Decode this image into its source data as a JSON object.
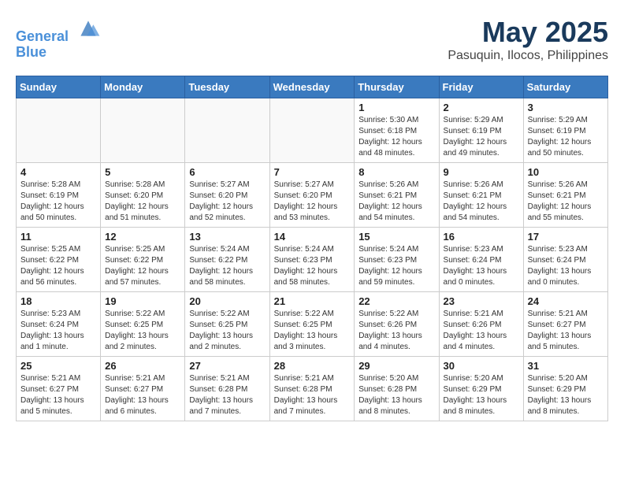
{
  "header": {
    "logo_line1": "General",
    "logo_line2": "Blue",
    "month_title": "May 2025",
    "location": "Pasuquin, Ilocos, Philippines"
  },
  "weekdays": [
    "Sunday",
    "Monday",
    "Tuesday",
    "Wednesday",
    "Thursday",
    "Friday",
    "Saturday"
  ],
  "weeks": [
    [
      {
        "day": "",
        "info": ""
      },
      {
        "day": "",
        "info": ""
      },
      {
        "day": "",
        "info": ""
      },
      {
        "day": "",
        "info": ""
      },
      {
        "day": "1",
        "info": "Sunrise: 5:30 AM\nSunset: 6:18 PM\nDaylight: 12 hours\nand 48 minutes."
      },
      {
        "day": "2",
        "info": "Sunrise: 5:29 AM\nSunset: 6:19 PM\nDaylight: 12 hours\nand 49 minutes."
      },
      {
        "day": "3",
        "info": "Sunrise: 5:29 AM\nSunset: 6:19 PM\nDaylight: 12 hours\nand 50 minutes."
      }
    ],
    [
      {
        "day": "4",
        "info": "Sunrise: 5:28 AM\nSunset: 6:19 PM\nDaylight: 12 hours\nand 50 minutes."
      },
      {
        "day": "5",
        "info": "Sunrise: 5:28 AM\nSunset: 6:20 PM\nDaylight: 12 hours\nand 51 minutes."
      },
      {
        "day": "6",
        "info": "Sunrise: 5:27 AM\nSunset: 6:20 PM\nDaylight: 12 hours\nand 52 minutes."
      },
      {
        "day": "7",
        "info": "Sunrise: 5:27 AM\nSunset: 6:20 PM\nDaylight: 12 hours\nand 53 minutes."
      },
      {
        "day": "8",
        "info": "Sunrise: 5:26 AM\nSunset: 6:21 PM\nDaylight: 12 hours\nand 54 minutes."
      },
      {
        "day": "9",
        "info": "Sunrise: 5:26 AM\nSunset: 6:21 PM\nDaylight: 12 hours\nand 54 minutes."
      },
      {
        "day": "10",
        "info": "Sunrise: 5:26 AM\nSunset: 6:21 PM\nDaylight: 12 hours\nand 55 minutes."
      }
    ],
    [
      {
        "day": "11",
        "info": "Sunrise: 5:25 AM\nSunset: 6:22 PM\nDaylight: 12 hours\nand 56 minutes."
      },
      {
        "day": "12",
        "info": "Sunrise: 5:25 AM\nSunset: 6:22 PM\nDaylight: 12 hours\nand 57 minutes."
      },
      {
        "day": "13",
        "info": "Sunrise: 5:24 AM\nSunset: 6:22 PM\nDaylight: 12 hours\nand 58 minutes."
      },
      {
        "day": "14",
        "info": "Sunrise: 5:24 AM\nSunset: 6:23 PM\nDaylight: 12 hours\nand 58 minutes."
      },
      {
        "day": "15",
        "info": "Sunrise: 5:24 AM\nSunset: 6:23 PM\nDaylight: 12 hours\nand 59 minutes."
      },
      {
        "day": "16",
        "info": "Sunrise: 5:23 AM\nSunset: 6:24 PM\nDaylight: 13 hours\nand 0 minutes."
      },
      {
        "day": "17",
        "info": "Sunrise: 5:23 AM\nSunset: 6:24 PM\nDaylight: 13 hours\nand 0 minutes."
      }
    ],
    [
      {
        "day": "18",
        "info": "Sunrise: 5:23 AM\nSunset: 6:24 PM\nDaylight: 13 hours\nand 1 minute."
      },
      {
        "day": "19",
        "info": "Sunrise: 5:22 AM\nSunset: 6:25 PM\nDaylight: 13 hours\nand 2 minutes."
      },
      {
        "day": "20",
        "info": "Sunrise: 5:22 AM\nSunset: 6:25 PM\nDaylight: 13 hours\nand 2 minutes."
      },
      {
        "day": "21",
        "info": "Sunrise: 5:22 AM\nSunset: 6:25 PM\nDaylight: 13 hours\nand 3 minutes."
      },
      {
        "day": "22",
        "info": "Sunrise: 5:22 AM\nSunset: 6:26 PM\nDaylight: 13 hours\nand 4 minutes."
      },
      {
        "day": "23",
        "info": "Sunrise: 5:21 AM\nSunset: 6:26 PM\nDaylight: 13 hours\nand 4 minutes."
      },
      {
        "day": "24",
        "info": "Sunrise: 5:21 AM\nSunset: 6:27 PM\nDaylight: 13 hours\nand 5 minutes."
      }
    ],
    [
      {
        "day": "25",
        "info": "Sunrise: 5:21 AM\nSunset: 6:27 PM\nDaylight: 13 hours\nand 5 minutes."
      },
      {
        "day": "26",
        "info": "Sunrise: 5:21 AM\nSunset: 6:27 PM\nDaylight: 13 hours\nand 6 minutes."
      },
      {
        "day": "27",
        "info": "Sunrise: 5:21 AM\nSunset: 6:28 PM\nDaylight: 13 hours\nand 7 minutes."
      },
      {
        "day": "28",
        "info": "Sunrise: 5:21 AM\nSunset: 6:28 PM\nDaylight: 13 hours\nand 7 minutes."
      },
      {
        "day": "29",
        "info": "Sunrise: 5:20 AM\nSunset: 6:28 PM\nDaylight: 13 hours\nand 8 minutes."
      },
      {
        "day": "30",
        "info": "Sunrise: 5:20 AM\nSunset: 6:29 PM\nDaylight: 13 hours\nand 8 minutes."
      },
      {
        "day": "31",
        "info": "Sunrise: 5:20 AM\nSunset: 6:29 PM\nDaylight: 13 hours\nand 8 minutes."
      }
    ]
  ]
}
